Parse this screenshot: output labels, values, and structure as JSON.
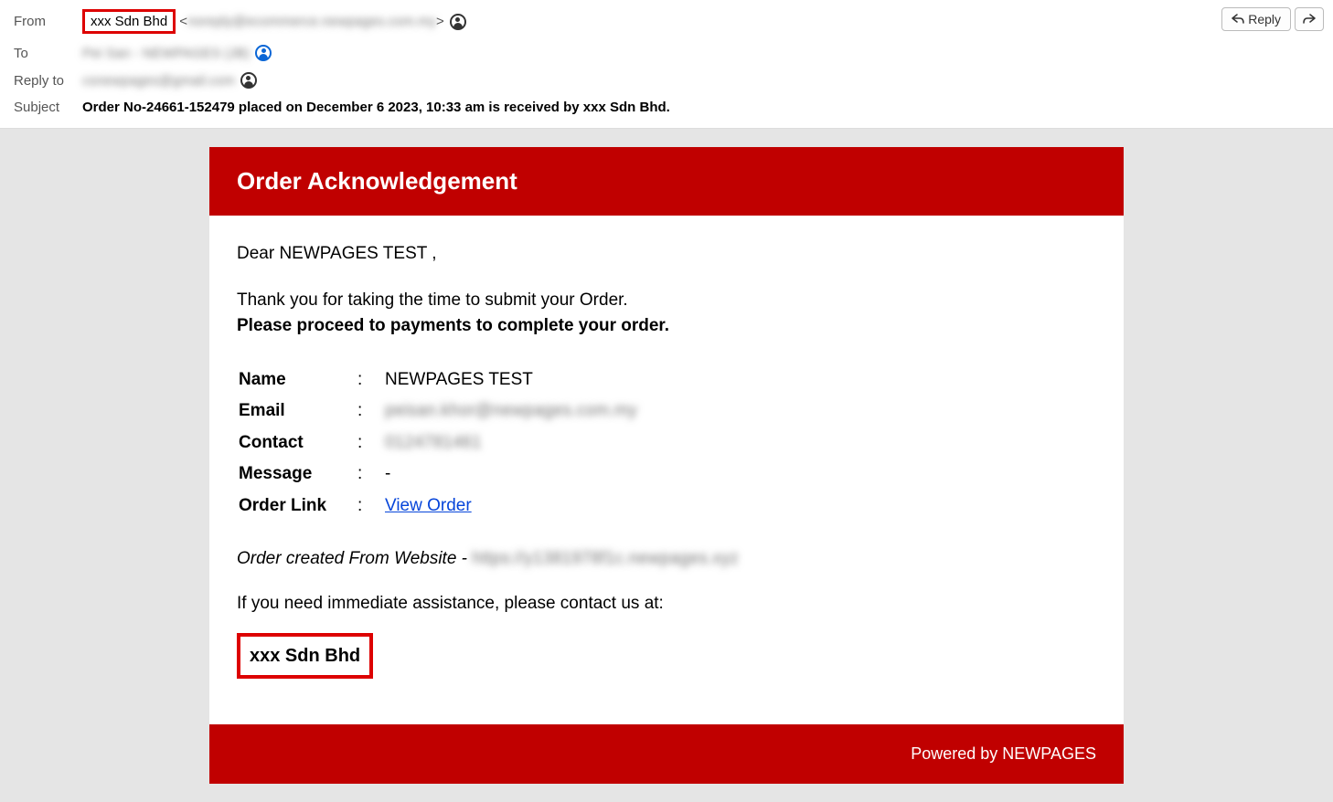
{
  "header": {
    "labels": {
      "from": "From",
      "to": "To",
      "replyto": "Reply to",
      "subject": "Subject"
    },
    "from_name": "xxx Sdn Bhd",
    "from_email_suffix": ">",
    "from_blur": "noreply@ecommerce.newpages.com.my",
    "to_blur": "Pei San - NEWPAGES (JB)",
    "replyto_blur": "csnewpages@gmail.com",
    "subject": "Order No-24661-152479 placed on December 6 2023, 10:33 am is received by xxx Sdn Bhd.",
    "reply_label": "Reply"
  },
  "body": {
    "title": "Order Acknowledgement",
    "greeting": "Dear NEWPAGES TEST ,",
    "intro_line1": "Thank you for taking the time to submit your Order.",
    "intro_line2": "Please proceed to payments to complete your order.",
    "labels": {
      "name": "Name",
      "email": "Email",
      "contact": "Contact",
      "message": "Message",
      "orderlink": "Order Link"
    },
    "colon": ":",
    "values": {
      "name": "NEWPAGES TEST",
      "email_blur": "peisan.khor@newpages.com.my",
      "contact_blur": "0124781461",
      "message": "-",
      "orderlink": "View Order"
    },
    "website_line_prefix": "Order created From Website - ",
    "website_blur": "https://y1381978f1c.newpages.xyz",
    "assistance": "If you need immediate assistance, please contact us at:",
    "company": "xxx Sdn Bhd",
    "footer": "Powered by NEWPAGES"
  }
}
